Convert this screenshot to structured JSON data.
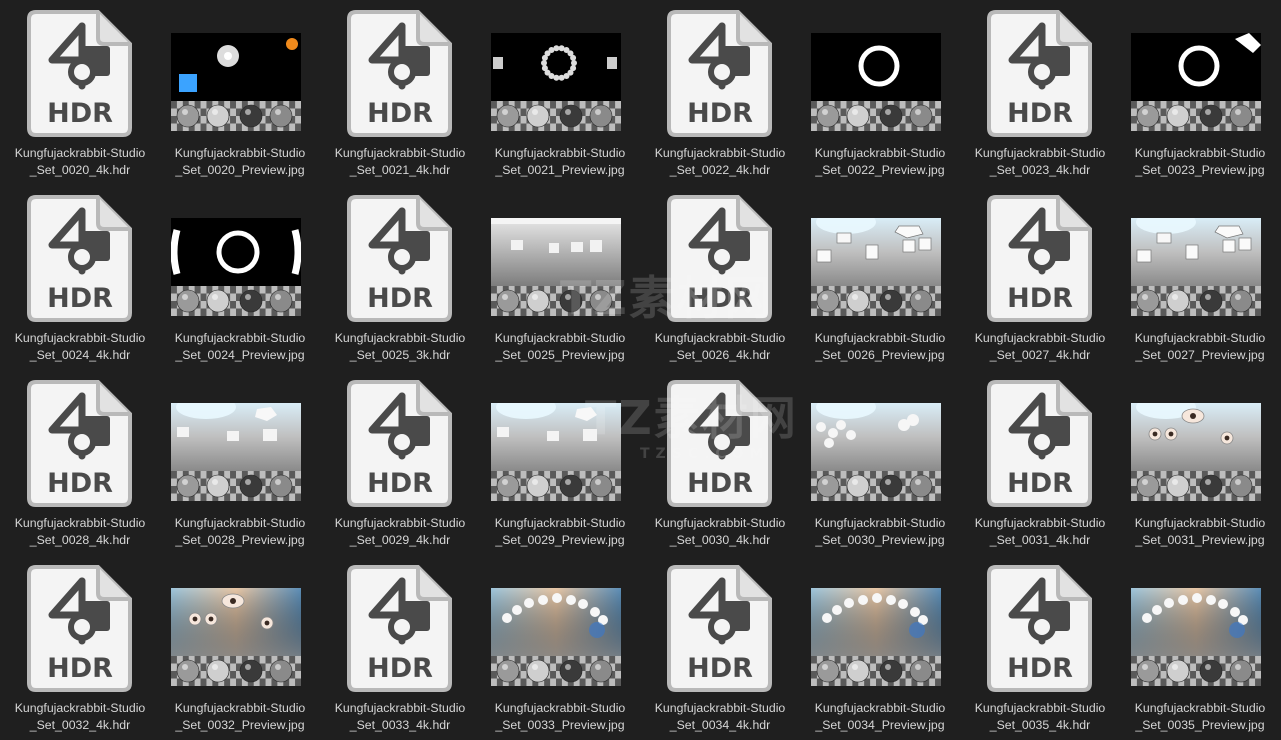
{
  "files": [
    {
      "type": "hdr",
      "line1": "Kungfujackrabbit-Studio",
      "line2": "_Set_0020_4k.hdr",
      "icon_label": "HDR"
    },
    {
      "type": "preview",
      "line1": "Kungfujackrabbit-Studio",
      "line2": "_Set_0020_Preview.jpg",
      "scene": "dark-ball"
    },
    {
      "type": "hdr",
      "line1": "Kungfujackrabbit-Studio",
      "line2": "_Set_0021_4k.hdr",
      "icon_label": "HDR"
    },
    {
      "type": "preview",
      "line1": "Kungfujackrabbit-Studio",
      "line2": "_Set_0021_Preview.jpg",
      "scene": "dark-beads"
    },
    {
      "type": "hdr",
      "line1": "Kungfujackrabbit-Studio",
      "line2": "_Set_0022_4k.hdr",
      "icon_label": "HDR"
    },
    {
      "type": "preview",
      "line1": "Kungfujackrabbit-Studio",
      "line2": "_Set_0022_Preview.jpg",
      "scene": "dark-ring"
    },
    {
      "type": "hdr",
      "line1": "Kungfujackrabbit-Studio",
      "line2": "_Set_0023_4k.hdr",
      "icon_label": "HDR"
    },
    {
      "type": "preview",
      "line1": "Kungfujackrabbit-Studio",
      "line2": "_Set_0023_Preview.jpg",
      "scene": "dark-ring-corner"
    },
    {
      "type": "hdr",
      "line1": "Kungfujackrabbit-Studio",
      "line2": "_Set_0024_4k.hdr",
      "icon_label": "HDR"
    },
    {
      "type": "preview",
      "line1": "Kungfujackrabbit-Studio",
      "line2": "_Set_0024_Preview.jpg",
      "scene": "dark-ring-arcs"
    },
    {
      "type": "hdr",
      "line1": "Kungfujackrabbit-Studio",
      "line2": "_Set_0025_3k.hdr",
      "icon_label": "HDR"
    },
    {
      "type": "preview",
      "line1": "Kungfujackrabbit-Studio",
      "line2": "_Set_0025_Preview.jpg",
      "scene": "grey-room"
    },
    {
      "type": "hdr",
      "line1": "Kungfujackrabbit-Studio",
      "line2": "_Set_0026_4k.hdr",
      "icon_label": "HDR"
    },
    {
      "type": "preview",
      "line1": "Kungfujackrabbit-Studio",
      "line2": "_Set_0026_Preview.jpg",
      "scene": "bright-boxes"
    },
    {
      "type": "hdr",
      "line1": "Kungfujackrabbit-Studio",
      "line2": "_Set_0027_4k.hdr",
      "icon_label": "HDR"
    },
    {
      "type": "preview",
      "line1": "Kungfujackrabbit-Studio",
      "line2": "_Set_0027_Preview.jpg",
      "scene": "bright-boxes"
    },
    {
      "type": "hdr",
      "line1": "Kungfujackrabbit-Studio",
      "line2": "_Set_0028_4k.hdr",
      "icon_label": "HDR"
    },
    {
      "type": "preview",
      "line1": "Kungfujackrabbit-Studio",
      "line2": "_Set_0028_Preview.jpg",
      "scene": "bright-softbox"
    },
    {
      "type": "hdr",
      "line1": "Kungfujackrabbit-Studio",
      "line2": "_Set_0029_4k.hdr",
      "icon_label": "HDR"
    },
    {
      "type": "preview",
      "line1": "Kungfujackrabbit-Studio",
      "line2": "_Set_0029_Preview.jpg",
      "scene": "bright-softbox"
    },
    {
      "type": "hdr",
      "line1": "Kungfujackrabbit-Studio",
      "line2": "_Set_0030_4k.hdr",
      "icon_label": "HDR"
    },
    {
      "type": "preview",
      "line1": "Kungfujackrabbit-Studio",
      "line2": "_Set_0030_Preview.jpg",
      "scene": "bright-balls"
    },
    {
      "type": "hdr",
      "line1": "Kungfujackrabbit-Studio",
      "line2": "_Set_0031_4k.hdr",
      "icon_label": "HDR"
    },
    {
      "type": "preview",
      "line1": "Kungfujackrabbit-Studio",
      "line2": "_Set_0031_Preview.jpg",
      "scene": "bright-eyes"
    },
    {
      "type": "hdr",
      "line1": "Kungfujackrabbit-Studio",
      "line2": "_Set_0032_4k.hdr",
      "icon_label": "HDR"
    },
    {
      "type": "preview",
      "line1": "Kungfujackrabbit-Studio",
      "line2": "_Set_0032_Preview.jpg",
      "scene": "warm-eyes"
    },
    {
      "type": "hdr",
      "line1": "Kungfujackrabbit-Studio",
      "line2": "_Set_0033_4k.hdr",
      "icon_label": "HDR"
    },
    {
      "type": "preview",
      "line1": "Kungfujackrabbit-Studio",
      "line2": "_Set_0033_Preview.jpg",
      "scene": "warm-arc"
    },
    {
      "type": "hdr",
      "line1": "Kungfujackrabbit-Studio",
      "line2": "_Set_0034_4k.hdr",
      "icon_label": "HDR"
    },
    {
      "type": "preview",
      "line1": "Kungfujackrabbit-Studio",
      "line2": "_Set_0034_Preview.jpg",
      "scene": "warm-arc"
    },
    {
      "type": "hdr",
      "line1": "Kungfujackrabbit-Studio",
      "line2": "_Set_0035_4k.hdr",
      "icon_label": "HDR"
    },
    {
      "type": "preview",
      "line1": "Kungfujackrabbit-Studio",
      "line2": "_Set_0035_Preview.jpg",
      "scene": "warm-arc"
    }
  ],
  "watermark": {
    "text_top": "TZ素材网",
    "text_mid": "TZ素材网",
    "text_domain": "TZSC.COM"
  },
  "colors": {
    "background": "#1f1f1f",
    "label_text": "#d6d6d6",
    "icon_body": "#f4f4f4",
    "icon_border": "#c8c8c8",
    "icon_glyph": "#4a4a4a"
  }
}
